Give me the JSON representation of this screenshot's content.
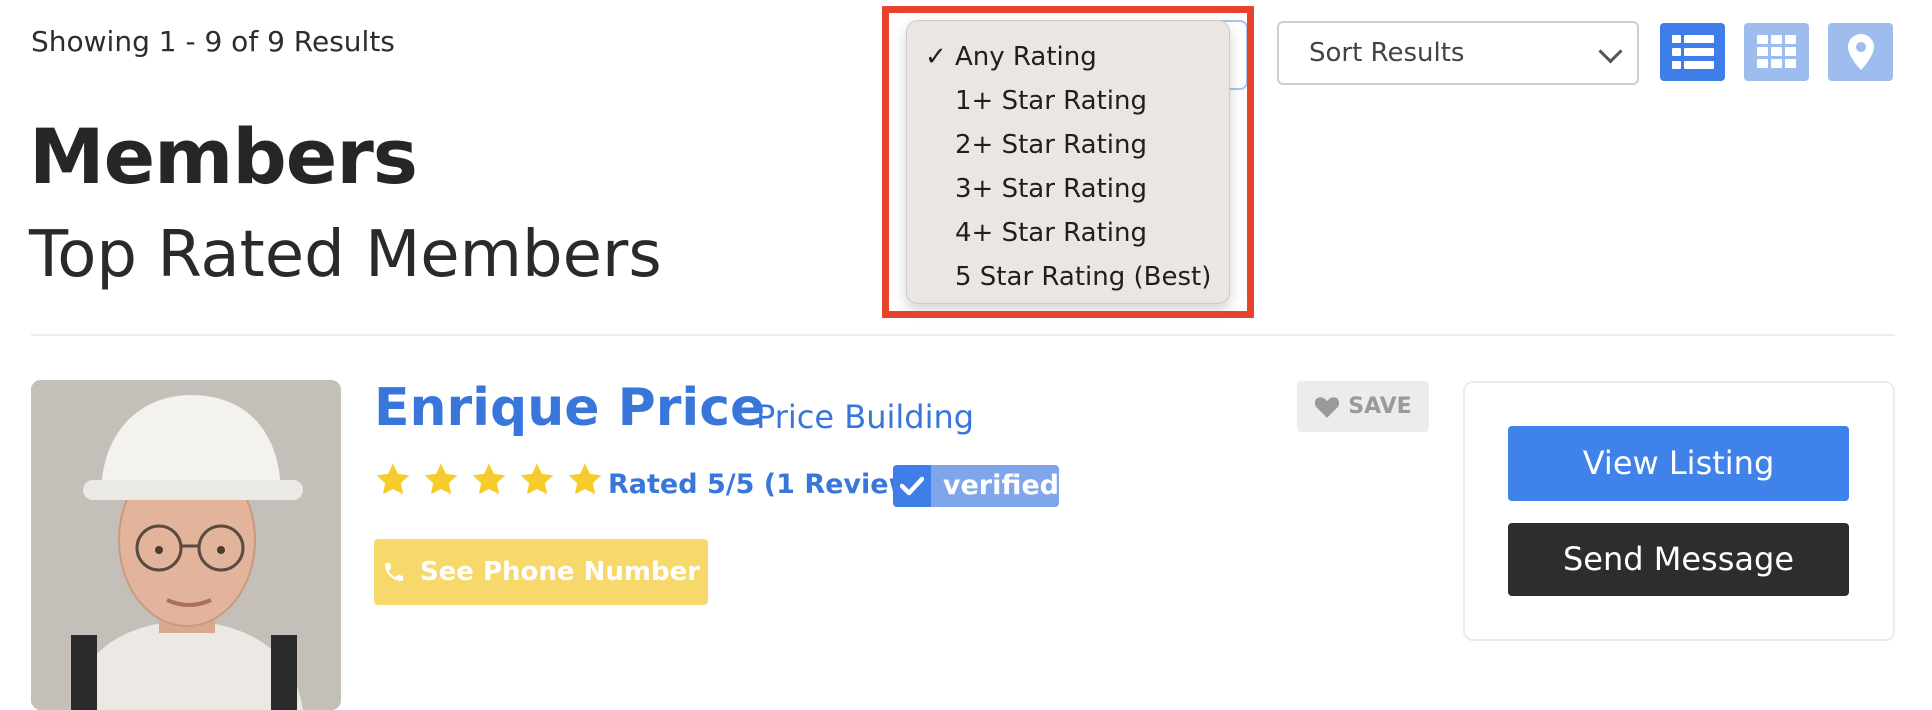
{
  "results": {
    "summary": "Showing 1 - 9 of 9 Results"
  },
  "page": {
    "title": "Members",
    "subtitle": "Top Rated Members"
  },
  "rating_filter": {
    "selected": "Any Rating",
    "options": [
      "Any Rating",
      "1+ Star Rating",
      "2+ Star Rating",
      "3+ Star Rating",
      "4+ Star Rating",
      "5 Star Rating (Best)"
    ]
  },
  "sort": {
    "value": "Sort Results"
  },
  "view_toggles": [
    {
      "name": "list-view",
      "icon": "list-icon",
      "active": true
    },
    {
      "name": "grid-view",
      "icon": "grid-icon",
      "active": false
    },
    {
      "name": "map-view",
      "icon": "map-pin-icon",
      "active": false
    }
  ],
  "member": {
    "name": "Enrique Price",
    "company": "Price Building",
    "stars": 5,
    "rating_text": "Rated 5/5 (1 Review)",
    "verified_label": "verified",
    "save_label": "SAVE",
    "phone_label": "See Phone Number",
    "view_listing_label": "View Listing",
    "send_message_label": "Send Message",
    "photo": "member-photo-hard-hat-worker"
  },
  "colors": {
    "accent_blue": "#3f7ee8",
    "link_blue": "#3877d9",
    "star_yellow": "#f5cc2c",
    "phone_yellow": "#f6d86b",
    "highlight_red": "#e8432d",
    "dark_button": "#2d2d2d"
  }
}
